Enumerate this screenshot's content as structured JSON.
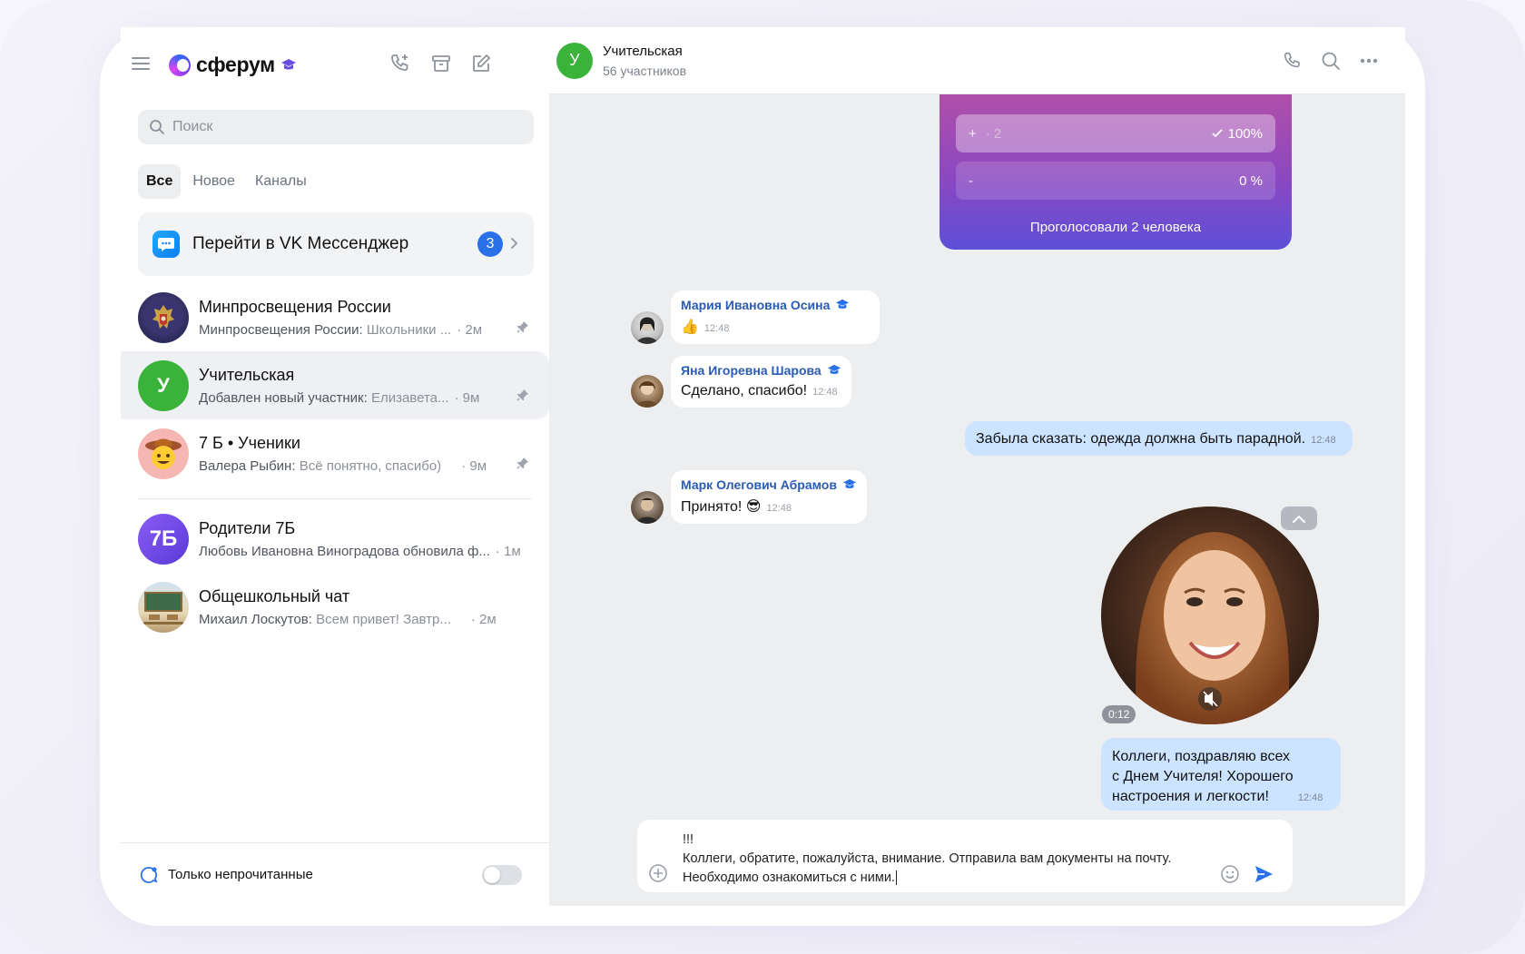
{
  "app": {
    "logo_text": "сферум",
    "accent_color": "#2a71e8",
    "brand_gradient": [
      "#2b6af5",
      "#7c3aed",
      "#d946ef"
    ]
  },
  "sidebar": {
    "search_placeholder": "Поиск",
    "tabs": [
      {
        "label": "Все",
        "active": true
      },
      {
        "label": "Новое",
        "active": false
      },
      {
        "label": "Каналы",
        "active": false
      }
    ],
    "vk_banner": {
      "label": "Перейти в VK Мессенджер",
      "badge": "3"
    },
    "chats": [
      {
        "title": "Минпросвещения России",
        "sender": "Минпросвещения России:",
        "preview": "Школьники ...",
        "time": "· 2м",
        "pinned": true,
        "avatar_icon": "emblem-icon"
      },
      {
        "title": "Учительская",
        "sender": "Добавлен новый участник:",
        "preview": "Елизавета...",
        "time": "· 9м",
        "pinned": true,
        "avatar_letter": "У",
        "active": true
      },
      {
        "title": "7 Б • Ученики",
        "sender": "Валера Рыбин:",
        "preview": "Всё понятно, спасибо)",
        "time": "· 9м",
        "pinned": true,
        "avatar_icon": "cowboy-emoji-icon"
      },
      {
        "title": "Родители 7Б",
        "sender": "Любовь Ивановна Виноградова обновила ф...",
        "preview": "",
        "time": "· 1м",
        "pinned": false,
        "avatar_letter": "7Б"
      },
      {
        "title": "Общешкольный чат",
        "sender": "Михаил Лоскутов:",
        "preview": "Всем привет! Завтр...",
        "time": "· 2м",
        "pinned": false,
        "avatar_icon": "classroom-icon"
      }
    ],
    "footer_label": "Только непрочитанные"
  },
  "header": {
    "avatar_letter": "У",
    "title": "Учительская",
    "subtitle": "56 участников"
  },
  "poll": {
    "options": [
      {
        "mark": "+",
        "muted": "· 2",
        "percent": "100%",
        "checked": true,
        "fill_fraction": 1.0
      },
      {
        "mark": "-",
        "muted": "",
        "percent": "0 %",
        "checked": false,
        "fill_fraction": 0.0
      }
    ],
    "footer": "Проголосовали 2 человека"
  },
  "messages": [
    {
      "author": "Мария Ивановна Осина",
      "text": "👍",
      "time": "12:48"
    },
    {
      "author": "Яна Игоревна Шарова",
      "text": "Сделано, спасибо!",
      "time": "12:48"
    },
    {
      "own_text": "Забыла сказать: одежда должна быть парадной.",
      "time": "12:48"
    },
    {
      "author": "Марк Олегович Абрамов",
      "text": "Принято! 😎",
      "time": "12:48"
    },
    {
      "video_duration": "0:12"
    },
    {
      "own_text_lines": [
        "Коллеги, поздравляю всех",
        "с Днем Учителя! Хорошего",
        "настроения и легкости!"
      ],
      "time": "12:48"
    }
  ],
  "composer": {
    "line1": "!!!",
    "line2": "Коллеги, обратите, пожалуйста, внимание. Отправила вам документы на почту.",
    "line3": "Необходимо ознакомиться с ними."
  }
}
